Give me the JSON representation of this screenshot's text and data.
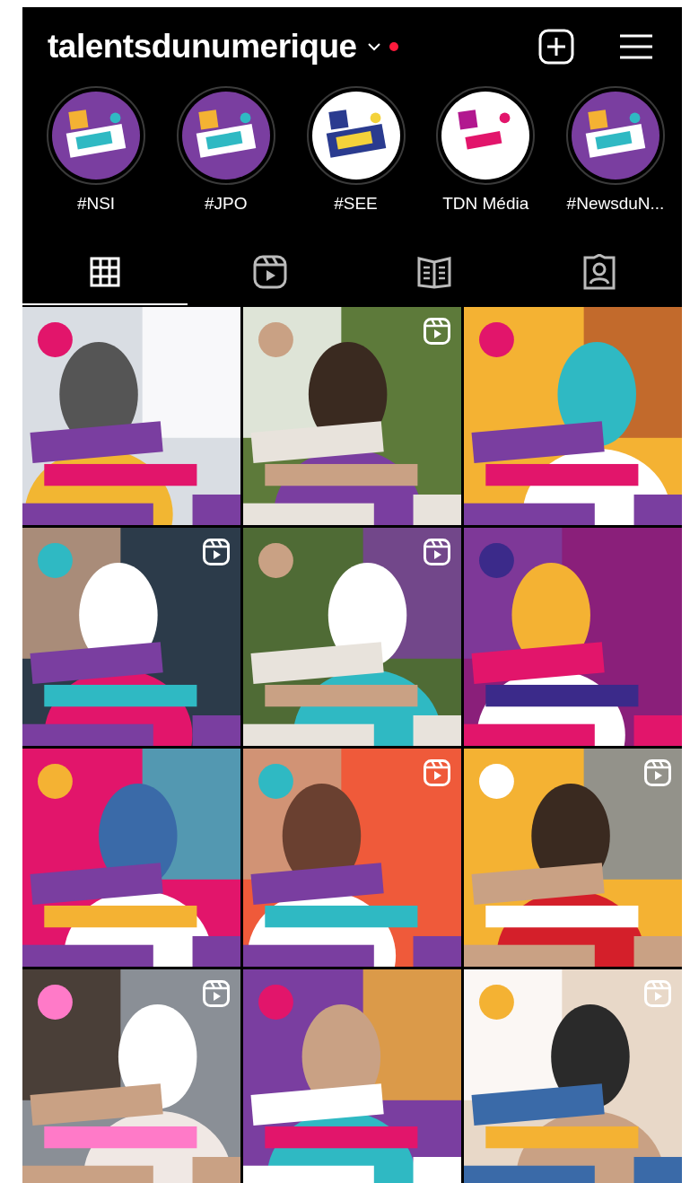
{
  "header": {
    "username": "talentsdunumerique",
    "has_dropdown": true,
    "notification_dot": true
  },
  "highlights": [
    {
      "label": "#NSI"
    },
    {
      "label": "#JPO"
    },
    {
      "label": "#SEE"
    },
    {
      "label": "TDN Média"
    },
    {
      "label": "#NewsduN..."
    }
  ],
  "tabs": [
    {
      "kind": "grid",
      "selected": true
    },
    {
      "kind": "reels",
      "selected": false
    },
    {
      "kind": "guides",
      "selected": false
    },
    {
      "kind": "tagged",
      "selected": false
    }
  ],
  "posts": [
    {
      "kind": "post"
    },
    {
      "kind": "reel"
    },
    {
      "kind": "post"
    },
    {
      "kind": "reel"
    },
    {
      "kind": "reel"
    },
    {
      "kind": "post"
    },
    {
      "kind": "post"
    },
    {
      "kind": "reel"
    },
    {
      "kind": "reel"
    },
    {
      "kind": "reel"
    },
    {
      "kind": "post"
    },
    {
      "kind": "reel"
    }
  ]
}
